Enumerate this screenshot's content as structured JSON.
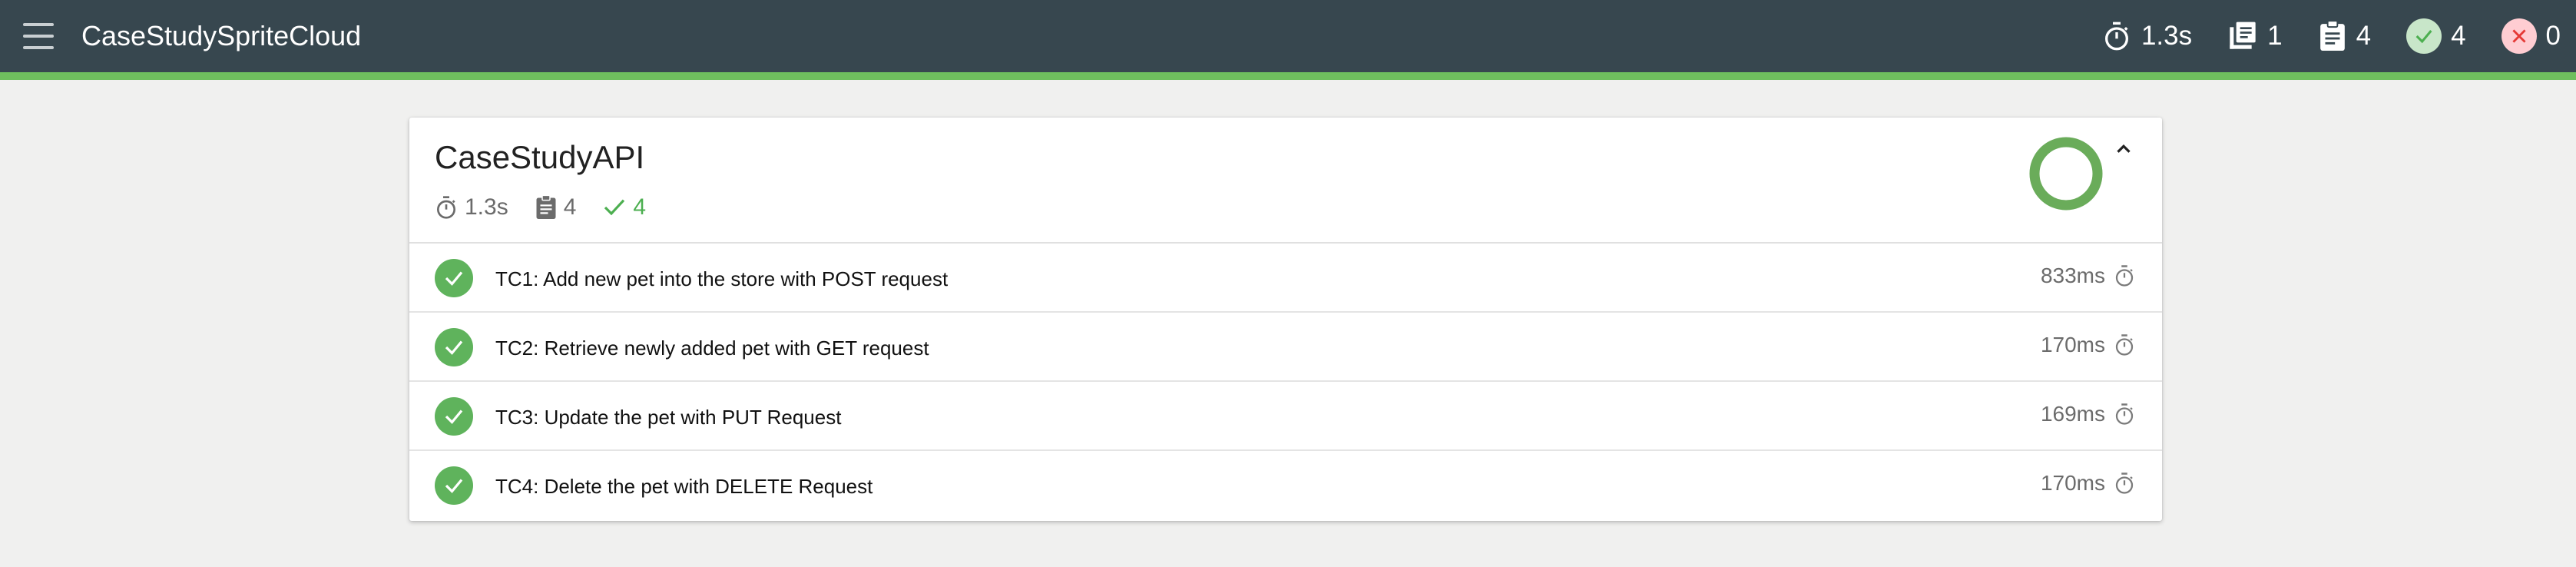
{
  "app": {
    "title": "CaseStudySpriteCloud"
  },
  "header_stats": {
    "duration": "1.3s",
    "suites": "1",
    "tests": "4",
    "passed": "4",
    "failed": "0"
  },
  "suite": {
    "title": "CaseStudyAPI",
    "duration": "1.3s",
    "tests": "4",
    "passed": "4",
    "pass_rate": 1.0
  },
  "tests": [
    {
      "name": "TC1: Add new pet into the store with POST request",
      "duration": "833ms",
      "status": "passed"
    },
    {
      "name": "TC2: Retrieve newly added pet with GET request",
      "duration": "170ms",
      "status": "passed"
    },
    {
      "name": "TC3: Update the pet with PUT Request",
      "duration": "169ms",
      "status": "passed"
    },
    {
      "name": "TC4: Delete the pet with DELETE Request",
      "duration": "170ms",
      "status": "passed"
    }
  ],
  "colors": {
    "topbar": "#37474f",
    "accent": "#6fbf5e",
    "pass": "#5fb35c",
    "fail_bg": "#ffcdd2"
  },
  "icons": [
    "menu-icon",
    "timer-icon",
    "suites-icon",
    "tests-icon",
    "check-icon",
    "close-icon",
    "chevron-up-icon"
  ]
}
